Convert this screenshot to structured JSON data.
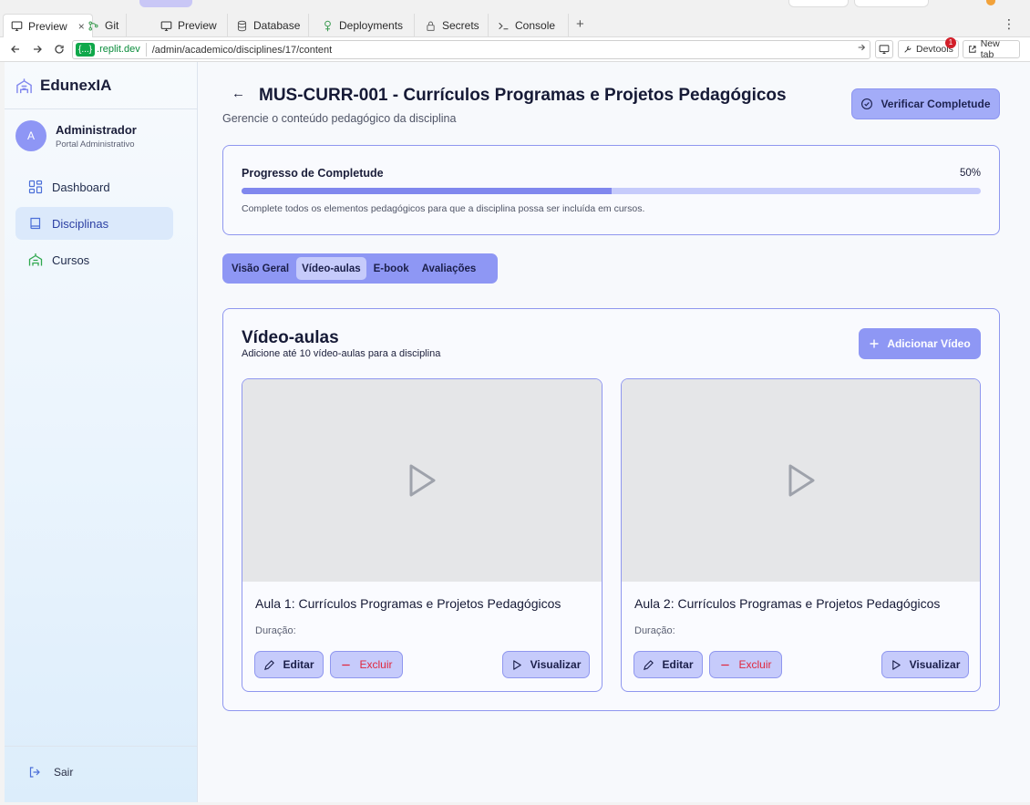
{
  "browser": {
    "tabs": [
      {
        "label": "Preview",
        "icon": "monitor-icon",
        "close": "×"
      },
      {
        "label": "Git",
        "icon": "git-branch-icon"
      },
      {
        "label": "Preview",
        "icon": "monitor-icon"
      },
      {
        "label": "Database",
        "icon": "database-icon"
      },
      {
        "label": "Deployments",
        "icon": "deployments-icon"
      },
      {
        "label": "Secrets",
        "icon": "lock-icon"
      },
      {
        "label": "Console",
        "icon": "terminal-icon"
      }
    ],
    "new_tab_symbol": "+",
    "menu_symbol": "⋮",
    "url": {
      "chip": "{...}",
      "host": ".replit.dev",
      "path": "/admin/academico/disciplines/17/content"
    },
    "devtools_label": "Devtools",
    "devtools_badge": "1",
    "newtab_label": "New tab"
  },
  "sidebar": {
    "brand": "EdunexIA",
    "user": {
      "initial": "A",
      "name": "Administrador",
      "role": "Portal Administrativo"
    },
    "items": [
      {
        "label": "Dashboard",
        "icon": "dashboard-grid-icon"
      },
      {
        "label": "Disciplinas",
        "icon": "book-icon",
        "active": true
      },
      {
        "label": "Cursos",
        "icon": "school-icon"
      }
    ],
    "logout": "Sair"
  },
  "header": {
    "back_symbol": "←",
    "title": "MUS-CURR-001 - Currículos Programas e Projetos Pedagógicos",
    "subtitle": "Gerencie o conteúdo pedagógico da disciplina",
    "verify_button": "Verificar Completude"
  },
  "progress": {
    "label": "Progresso de Completude",
    "percent_text": "50%",
    "value": 0.5,
    "note": "Complete todos os elementos pedagógicos para que a disciplina possa ser incluída em cursos."
  },
  "tabs": [
    {
      "label": "Visão Geral"
    },
    {
      "label": "Vídeo-aulas",
      "active": true
    },
    {
      "label": "E-book"
    },
    {
      "label": "Avaliações"
    }
  ],
  "videos_section": {
    "title": "Vídeo-aulas",
    "subtitle": "Adicione até 10 vídeo-aulas para a disciplina",
    "add_button": "Adicionar Vídeo",
    "videos": [
      {
        "title": "Aula 1: Currículos Programas e Projetos Pedagógicos",
        "duration_label": "Duração:",
        "edit": "Editar",
        "delete": "Excluir",
        "view": "Visualizar"
      },
      {
        "title": "Aula 2: Currículos Programas e Projetos Pedagógicos",
        "duration_label": "Duração:",
        "edit": "Editar",
        "delete": "Excluir",
        "view": "Visualizar"
      }
    ]
  },
  "colors": {
    "accent": "#8e97f4",
    "accent_light": "#c6cbfb",
    "danger": "#e0283e",
    "progress_fill": "#8087ee"
  }
}
